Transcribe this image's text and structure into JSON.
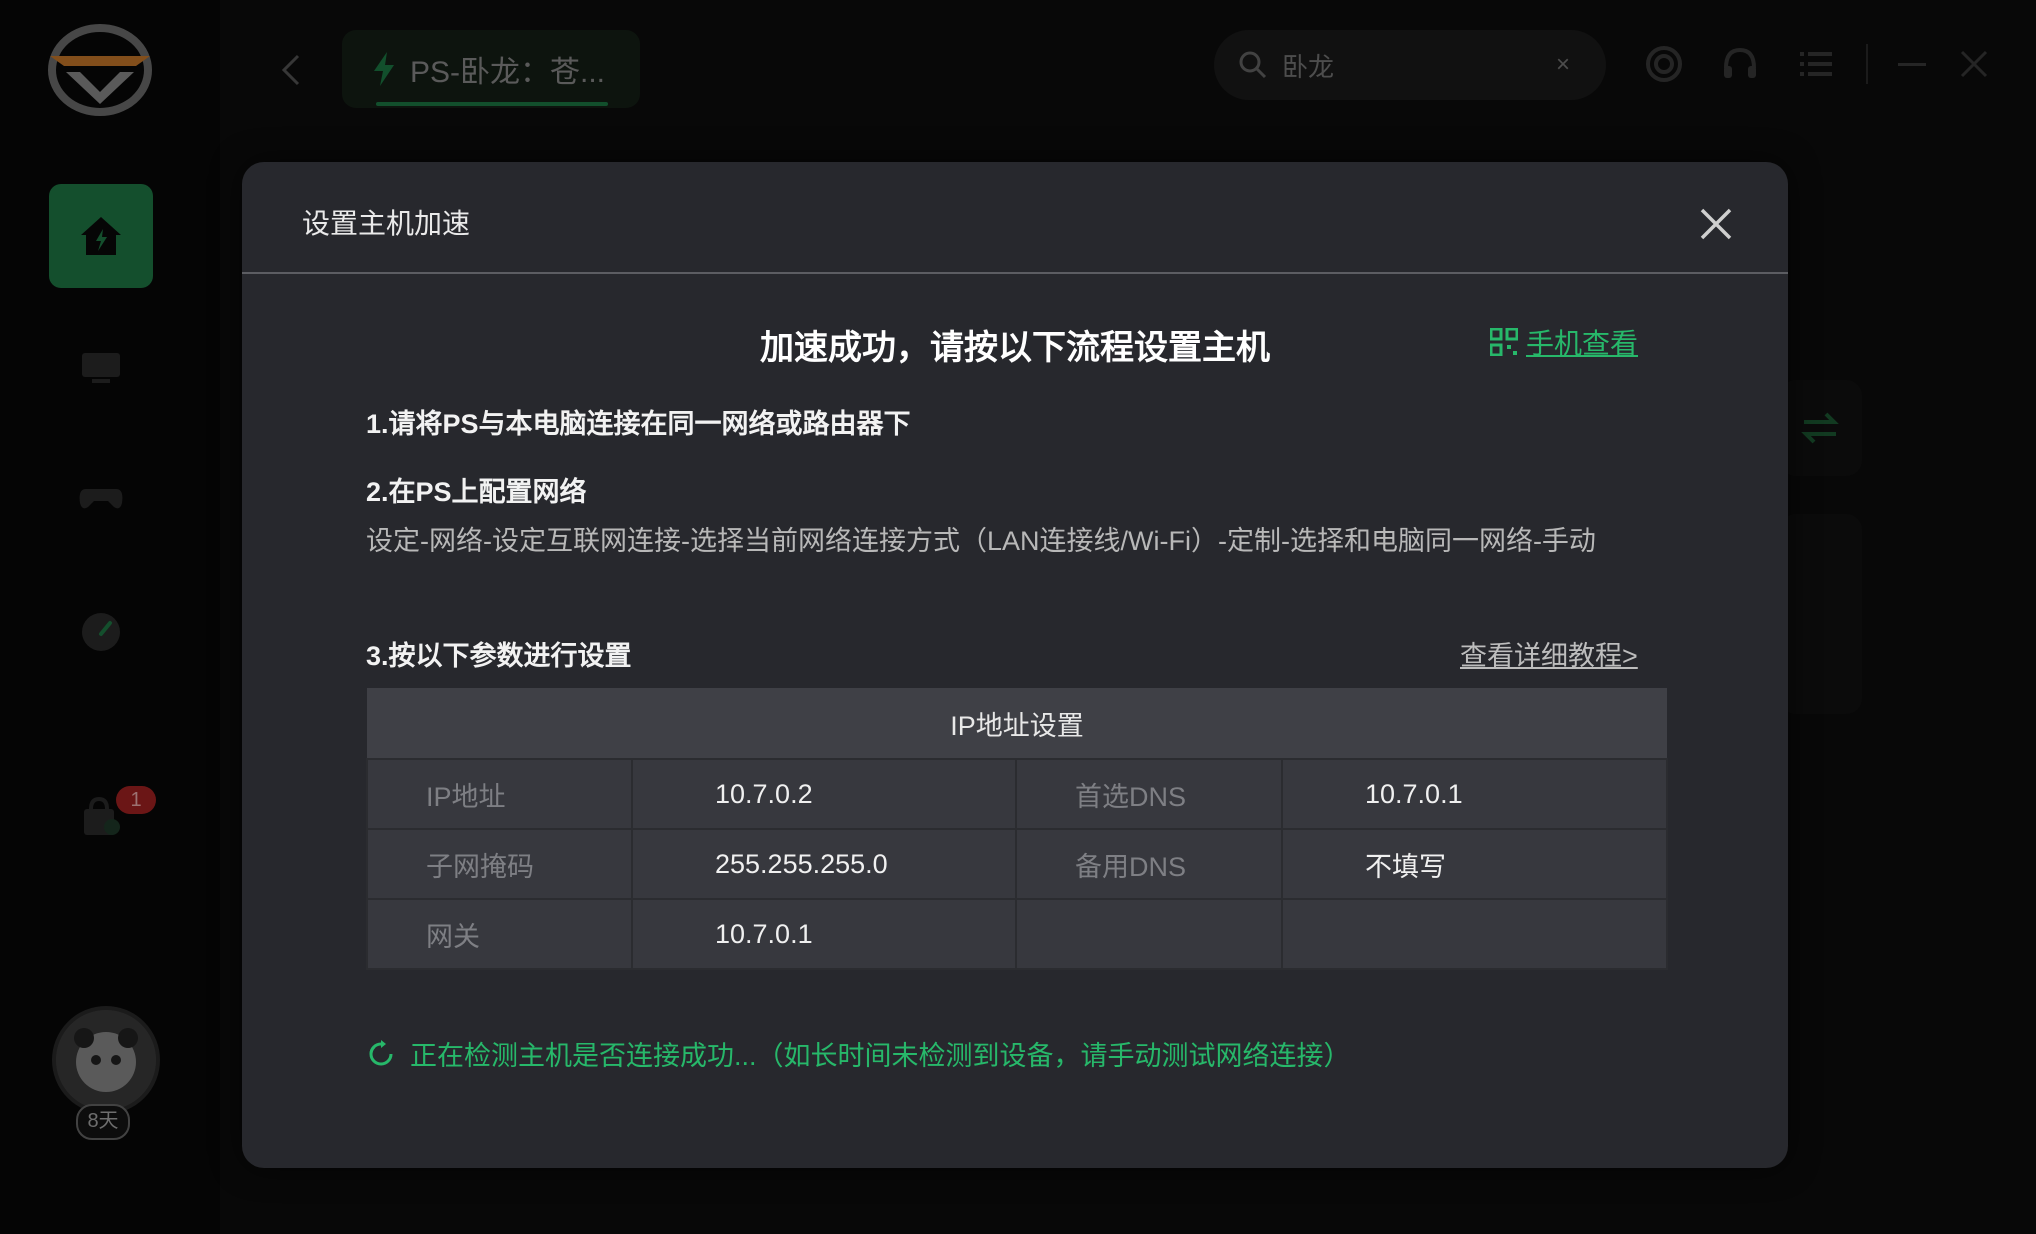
{
  "app": {
    "game_tab_label": "PS-卧龙：苍...",
    "search_value": "卧龙",
    "clear_label": "×",
    "badge_count": "1",
    "member_days": "8天",
    "accent_color": "#27b86a"
  },
  "dialog": {
    "title": "设置主机加速",
    "headline": "加速成功，请按以下流程设置主机",
    "phone_view_label": "手机查看",
    "step1": "1.请将PS与本电脑连接在同一网络或路由器下",
    "step2": "2.在PS上配置网络",
    "step2_desc": "设定-网络-设定互联网连接-选择当前网络连接方式（LAN连接线/Wi-Fi）-定制-选择和电脑同一网络-手动",
    "step3": "3.按以下参数进行设置",
    "tutorial_link": "查看详细教程>",
    "table_header": "IP地址设置",
    "rows": [
      {
        "label1": "IP地址",
        "value1": "10.7.0.2",
        "label2": "首选DNS",
        "value2": "10.7.0.1"
      },
      {
        "label1": "子网掩码",
        "value1": "255.255.255.0",
        "label2": "备用DNS",
        "value2": "不填写"
      },
      {
        "label1": "网关",
        "value1": "10.7.0.1",
        "label2": "",
        "value2": ""
      }
    ],
    "status_text": "正在检测主机是否连接成功...（如长时间未检测到设备，请手动测试网络连接）"
  }
}
